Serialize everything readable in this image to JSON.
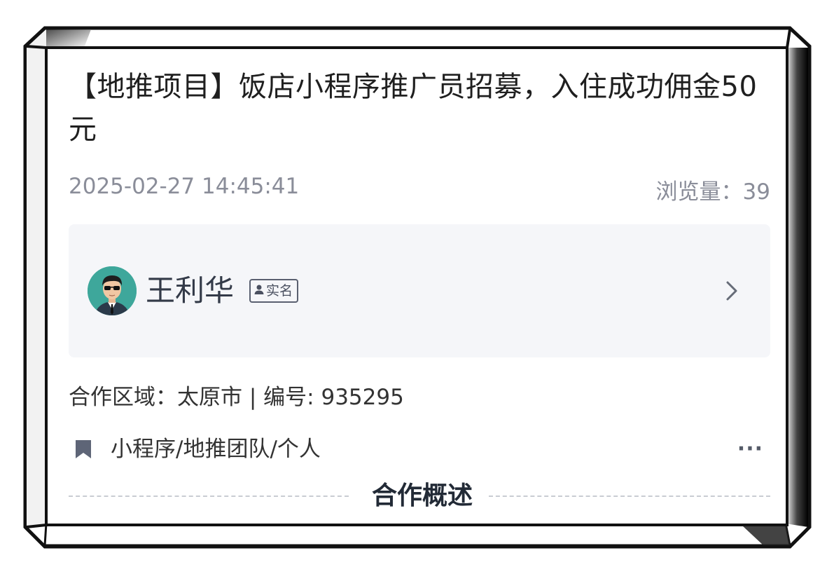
{
  "post": {
    "title": "【地推项目】饭店小程序推广员招募，入住成功佣金50元",
    "datetime": "2025-02-27 14:45:41",
    "views_label": "浏览量：",
    "views_count": "39"
  },
  "author": {
    "name": "王利华",
    "badge_label": "实名",
    "avatar_icon": "avatar-man-sunglasses-icon",
    "chevron_icon": "chevron-right-icon"
  },
  "details": {
    "area_label": "合作区域：",
    "area_value": "太原市",
    "separator": "|",
    "number_label": "编号:",
    "number_value": "935295"
  },
  "tags": {
    "icon": "bookmark-icon",
    "text": "小程序/地推团队/个人",
    "more_label": "···"
  },
  "section": {
    "heading": "合作概述"
  },
  "colors": {
    "card_bg": "#ffffff",
    "author_box_bg": "#f5f6f9",
    "meta_text": "#8a8d99",
    "title_text": "#1f1f1f",
    "avatar_bg": "#3ea79b"
  }
}
